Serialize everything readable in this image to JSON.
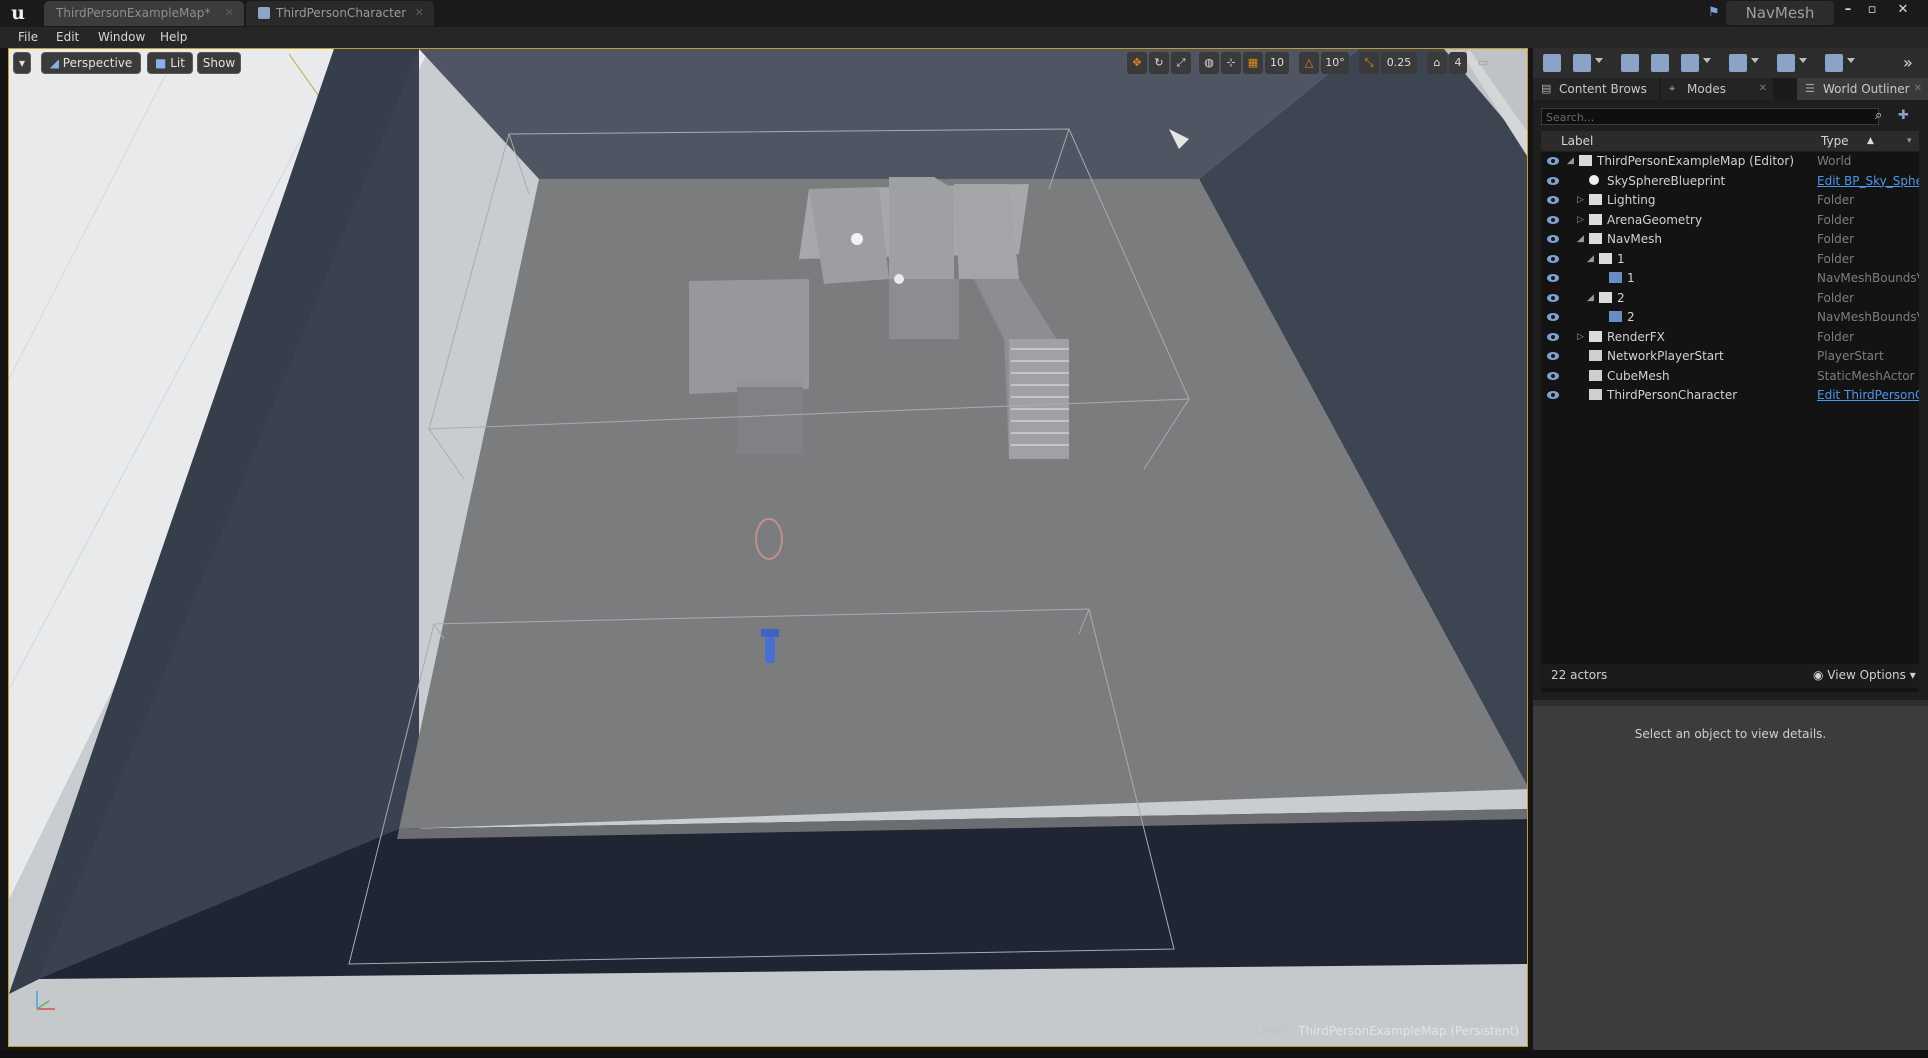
{
  "title_bar": {
    "tabs": [
      {
        "label": "ThirdPersonExampleMap*"
      },
      {
        "label": "ThirdPersonCharacter"
      }
    ],
    "project_name": "NavMesh",
    "window_buttons": [
      "minimize",
      "maximize",
      "close"
    ]
  },
  "menu_bar": {
    "items": [
      "File",
      "Edit",
      "Window",
      "Help"
    ]
  },
  "viewport": {
    "perspective_label": "Perspective",
    "lit_label": "Lit",
    "show_label": "Show",
    "snap": {
      "grid_value": "10",
      "rotation_value": "10°",
      "scale_value": "0.25",
      "camera_speed": "4"
    },
    "level_prefix": "Level:",
    "level_name": "ThirdPersonExampleMap (Persistent)"
  },
  "right_panel": {
    "tabs": [
      {
        "label": "Content Brows",
        "icon": "content-browser-icon"
      },
      {
        "label": "Modes",
        "icon": "modes-icon"
      },
      {
        "label": "World Outliner",
        "icon": "world-outliner-icon"
      }
    ],
    "search_placeholder": "Search...",
    "columns": {
      "label": "Label",
      "type": "Type"
    },
    "rows": [
      {
        "label": "ThirdPersonExampleMap (Editor)",
        "type": "World",
        "indent": 0,
        "expander": "open",
        "icon": "world-icon",
        "link": false
      },
      {
        "label": "SkySphereBlueprint",
        "type": "Edit BP_Sky_Sphe",
        "indent": 1,
        "expander": "",
        "icon": "sphere-icon",
        "link": true
      },
      {
        "label": "Lighting",
        "type": "Folder",
        "indent": 1,
        "expander": "closed",
        "icon": "folder-icon",
        "link": false
      },
      {
        "label": "ArenaGeometry",
        "type": "Folder",
        "indent": 1,
        "expander": "closed",
        "icon": "folder-icon",
        "link": false
      },
      {
        "label": "NavMesh",
        "type": "Folder",
        "indent": 1,
        "expander": "open",
        "icon": "folder-icon",
        "link": false
      },
      {
        "label": "1",
        "type": "Folder",
        "indent": 2,
        "expander": "open",
        "icon": "folder-icon",
        "link": false
      },
      {
        "label": "1",
        "type": "NavMeshBoundsVc",
        "indent": 3,
        "expander": "",
        "icon": "navmesh-bounds-icon",
        "link": false
      },
      {
        "label": "2",
        "type": "Folder",
        "indent": 2,
        "expander": "open",
        "icon": "folder-icon",
        "link": false
      },
      {
        "label": "2",
        "type": "NavMeshBoundsVc",
        "indent": 3,
        "expander": "",
        "icon": "navmesh-bounds-icon",
        "link": false
      },
      {
        "label": "RenderFX",
        "type": "Folder",
        "indent": 1,
        "expander": "closed",
        "icon": "folder-icon",
        "link": false
      },
      {
        "label": "NetworkPlayerStart",
        "type": "PlayerStart",
        "indent": 1,
        "expander": "",
        "icon": "player-start-icon",
        "link": false
      },
      {
        "label": "CubeMesh",
        "type": "StaticMeshActor",
        "indent": 1,
        "expander": "",
        "icon": "static-mesh-icon",
        "link": false
      },
      {
        "label": "ThirdPersonCharacter",
        "type": "Edit ThirdPersonC",
        "indent": 1,
        "expander": "",
        "icon": "character-icon",
        "link": true
      }
    ],
    "actor_count": "22 actors",
    "view_options_label": "View Options",
    "details_message": "Select an object to view details."
  }
}
